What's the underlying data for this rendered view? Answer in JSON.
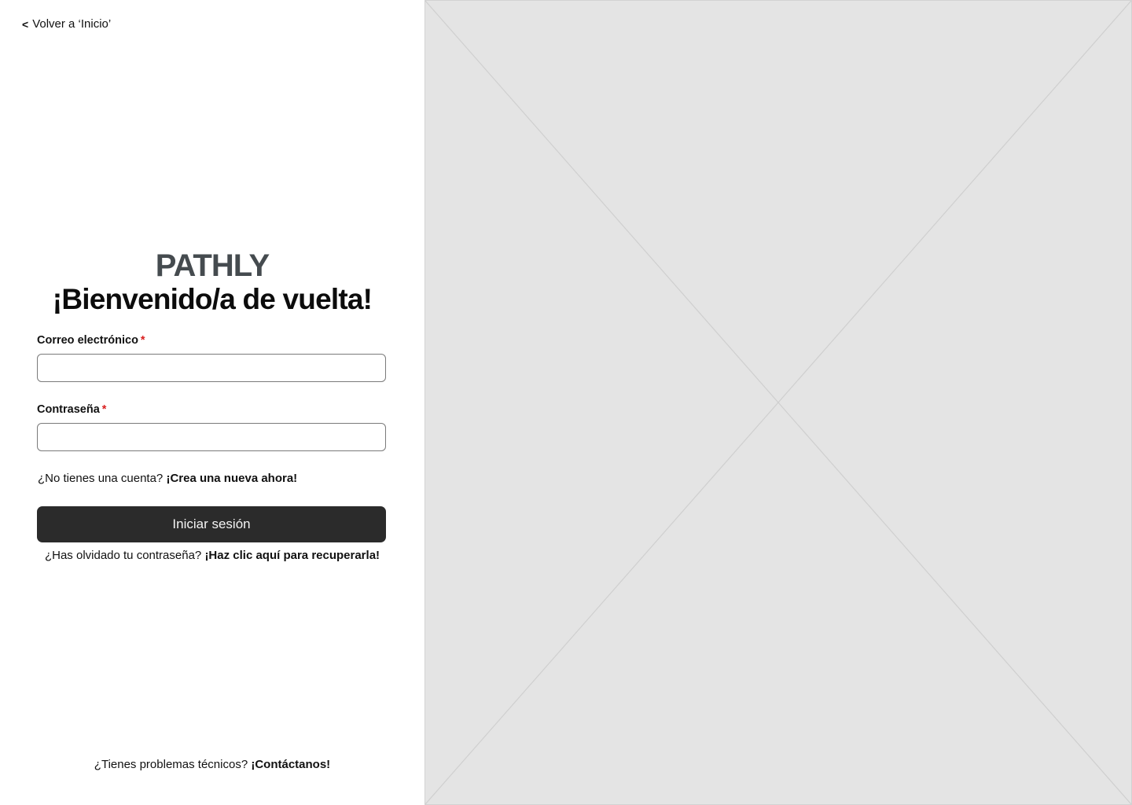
{
  "nav": {
    "back_chevron": "<",
    "back_label": "Volver a ‘Inicio’"
  },
  "brand": {
    "logo_text": "PATHLY",
    "logo_color": "#454b4f"
  },
  "form": {
    "heading": "¡Bienvenido/a de vuelta!",
    "email_label": "Correo electrónico",
    "email_value": "",
    "password_label": "Contraseña",
    "password_value": "",
    "required_marker": "*",
    "required_color": "#d92020",
    "signup_prompt": "¿No tienes una cuenta?",
    "signup_link": "¡Crea una nueva ahora!",
    "submit_label": "Iniciar sesión",
    "submit_color": "#2b2b2b",
    "forgot_prompt": "¿Has olvidado tu contraseña?",
    "forgot_link": "¡Haz clic aquí para recuperarla!"
  },
  "footer": {
    "support_prompt": "¿Tienes problemas técnicos?",
    "support_link": "¡Contáctanos!"
  },
  "image_placeholder": {
    "background_color": "#e4e4e4",
    "icon": "image-placeholder-icon"
  }
}
